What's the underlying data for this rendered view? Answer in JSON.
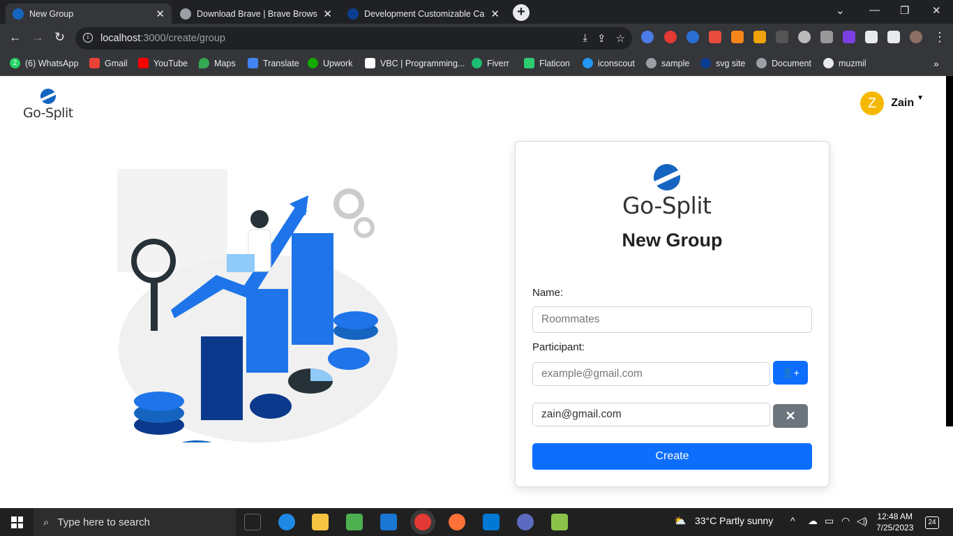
{
  "browser": {
    "tabs": [
      {
        "title": "New Group",
        "active": true
      },
      {
        "title": "Download Brave | Brave Browser",
        "active": false
      },
      {
        "title": "Development Customizable Carto",
        "active": false
      }
    ],
    "url_host": "localhost",
    "url_path": ":3000/create/group",
    "bookmarks": [
      "(6) WhatsApp",
      "Gmail",
      "YouTube",
      "Maps",
      "Translate",
      "Upwork",
      "VBC | Programming...",
      "Fiverr",
      "Flaticon",
      "iconscout",
      "sample",
      "svg site",
      "Document",
      "muzmil"
    ],
    "bookmark_whatsapp_badge": "2"
  },
  "header": {
    "logo_text": "Go-Split",
    "user_initial": "Z",
    "user_name": "Zain"
  },
  "form": {
    "logo_text": "Go-Split",
    "title": "New Group",
    "name_label": "Name:",
    "name_placeholder": "Roommates",
    "participant_label": "Participant:",
    "participant_placeholder": "example@gmail.com",
    "participants": [
      "zain@gmail.com"
    ],
    "create_label": "Create"
  },
  "taskbar": {
    "search_placeholder": "Type here to search",
    "weather": "33°C  Partly sunny",
    "time": "12:48 AM",
    "date": "7/25/2023",
    "notifications": "24"
  },
  "colors": {
    "primary": "#0d6efd",
    "secondary": "#6c757d",
    "avatar": "#f5b800",
    "brand": "#1565c0"
  }
}
